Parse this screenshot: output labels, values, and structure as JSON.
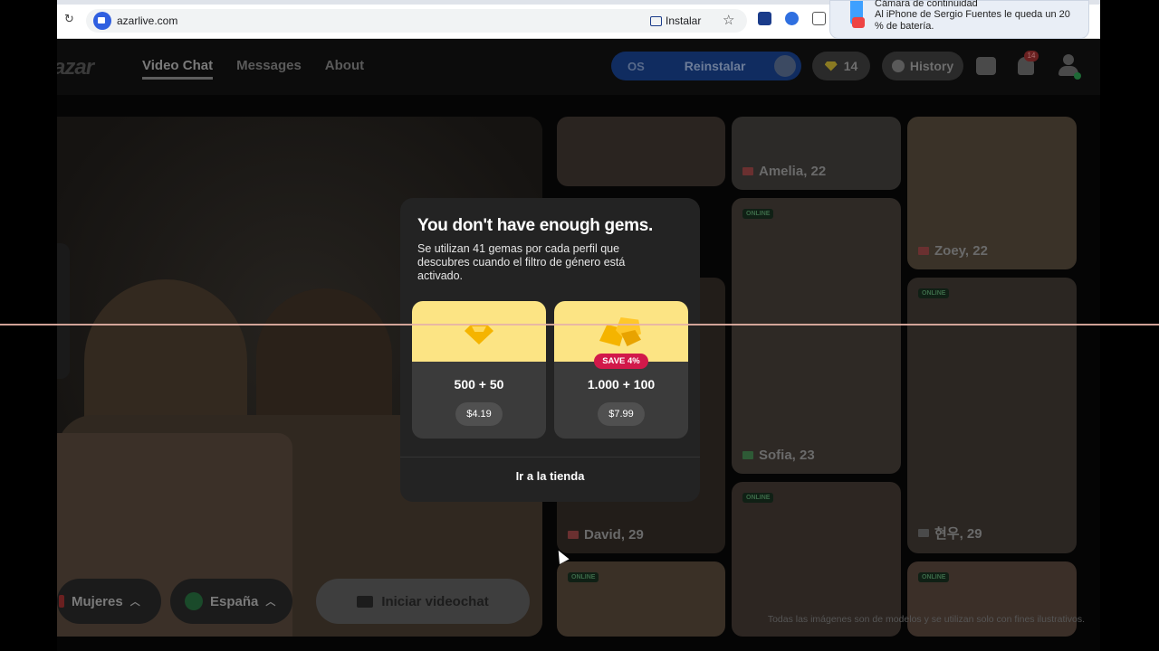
{
  "browser": {
    "url": "azarlive.com",
    "install_label": "Instalar"
  },
  "notification": {
    "title": "Cámara de continuidad",
    "body": "Al iPhone de Sergio Fuentes le queda un 20 % de batería."
  },
  "header": {
    "logo": "azar",
    "nav": [
      {
        "label": "Video Chat",
        "active": true
      },
      {
        "label": "Messages",
        "active": false
      },
      {
        "label": "About",
        "active": false
      }
    ],
    "promo_os": "OS",
    "promo_label": "Reinstalar",
    "gems_count": "14",
    "history_label": "History",
    "notifications_badge": "14"
  },
  "video": {
    "gender_filter": "Mujeres",
    "country_filter": "España",
    "start_button": "Iniciar videochat"
  },
  "profiles": [
    {
      "name": "",
      "online": false,
      "flag_color": "#2a2a2a",
      "bg": "#2a2420"
    },
    {
      "name": "Amelia, 22",
      "online": false,
      "flag_color": "#6a3030",
      "bg": "#2c2a28"
    },
    {
      "name": "",
      "online": false,
      "flag_color": "#2a2a2a",
      "bg": "#3a3228"
    },
    {
      "name": "Zoey, 22",
      "online": false,
      "flag_color": "#6a3030",
      "bg": "#3a3326"
    },
    {
      "name": "",
      "online": true,
      "flag_color": "#2a2a2a",
      "bg": "#231f1c"
    },
    {
      "name": "Sofia, 23",
      "online": true,
      "flag_color": "#2e5a36",
      "bg": "#2e2925"
    },
    {
      "name": "현우, 29",
      "online": true,
      "flag_color": "#4a4a4a",
      "bg": "#2b2622"
    },
    {
      "name": "David, 29",
      "online": false,
      "flag_color": "#6a3030",
      "bg": "#221d19"
    },
    {
      "name": "",
      "online": true,
      "flag_color": "#2a2a2a",
      "bg": "#3a3026"
    },
    {
      "name": "",
      "online": true,
      "flag_color": "#2a2a2a",
      "bg": "#2d2622"
    },
    {
      "name": "",
      "online": true,
      "flag_color": "#2a2a2a",
      "bg": "#3b2f28"
    }
  ],
  "online_label": "ONLINE",
  "disclaimer": "Todas las imágenes son de modelos y se utilizan solo con fines ilustrativos.",
  "modal": {
    "title": "You don't have enough gems.",
    "description": "Se utilizan 41 gemas por cada perfil que descubres cuando el filtro de género está activado.",
    "packs": [
      {
        "amount": "500 + 50",
        "price": "$4.19",
        "badge": ""
      },
      {
        "amount": "1.000 + 100",
        "price": "$7.99",
        "badge": "SAVE 4%"
      }
    ],
    "store_button": "Ir a la tienda"
  },
  "colors": {
    "pack_top": "#fce484",
    "gem": "#f5b400",
    "save_badge": "#d2194a",
    "modal_bg": "#232323"
  }
}
